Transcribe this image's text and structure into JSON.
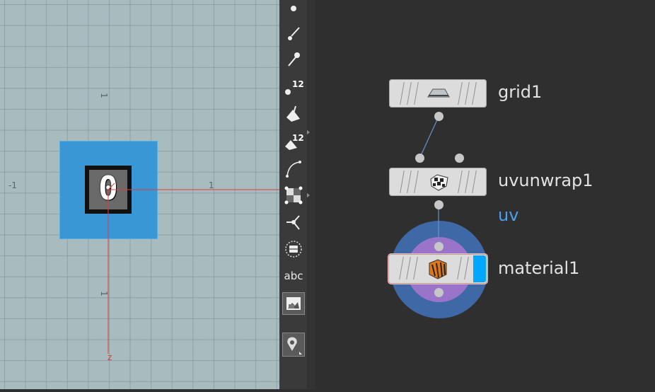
{
  "viewport": {
    "axis_labels": [
      "-1",
      "1",
      "1",
      "1",
      "z"
    ],
    "uv_tile_digit": "0"
  },
  "shelf": {
    "tools": [
      {
        "name": "point-icon"
      },
      {
        "name": "brush-icon"
      },
      {
        "name": "pin-icon"
      },
      {
        "name": "point-number-icon",
        "badge": "12"
      },
      {
        "name": "primitive-icon"
      },
      {
        "name": "primitive-number-icon",
        "badge": "12"
      },
      {
        "name": "curve-icon"
      },
      {
        "name": "uv-checker-icon"
      },
      {
        "name": "normals-icon"
      },
      {
        "name": "backface-icon"
      },
      {
        "name": "text-icon",
        "label": "abc"
      },
      {
        "name": "background-image-icon"
      },
      {
        "name": "location-pin-icon"
      }
    ]
  },
  "network": {
    "nodes": [
      {
        "label": "grid1",
        "icon": "grid-plane-icon"
      },
      {
        "label": "uvunwrap1",
        "icon": "uv-unwrap-icon"
      },
      {
        "label": "material1",
        "icon": "material-icon",
        "display_flag_color": "#00a6ff"
      }
    ],
    "attribute_label": "uv",
    "colors": {
      "attribute_label": "#4c9ef0",
      "halo_outer": "#3f68a6",
      "halo_inner": "#9a74c8",
      "selection_outline": "#ffb3b3"
    }
  }
}
